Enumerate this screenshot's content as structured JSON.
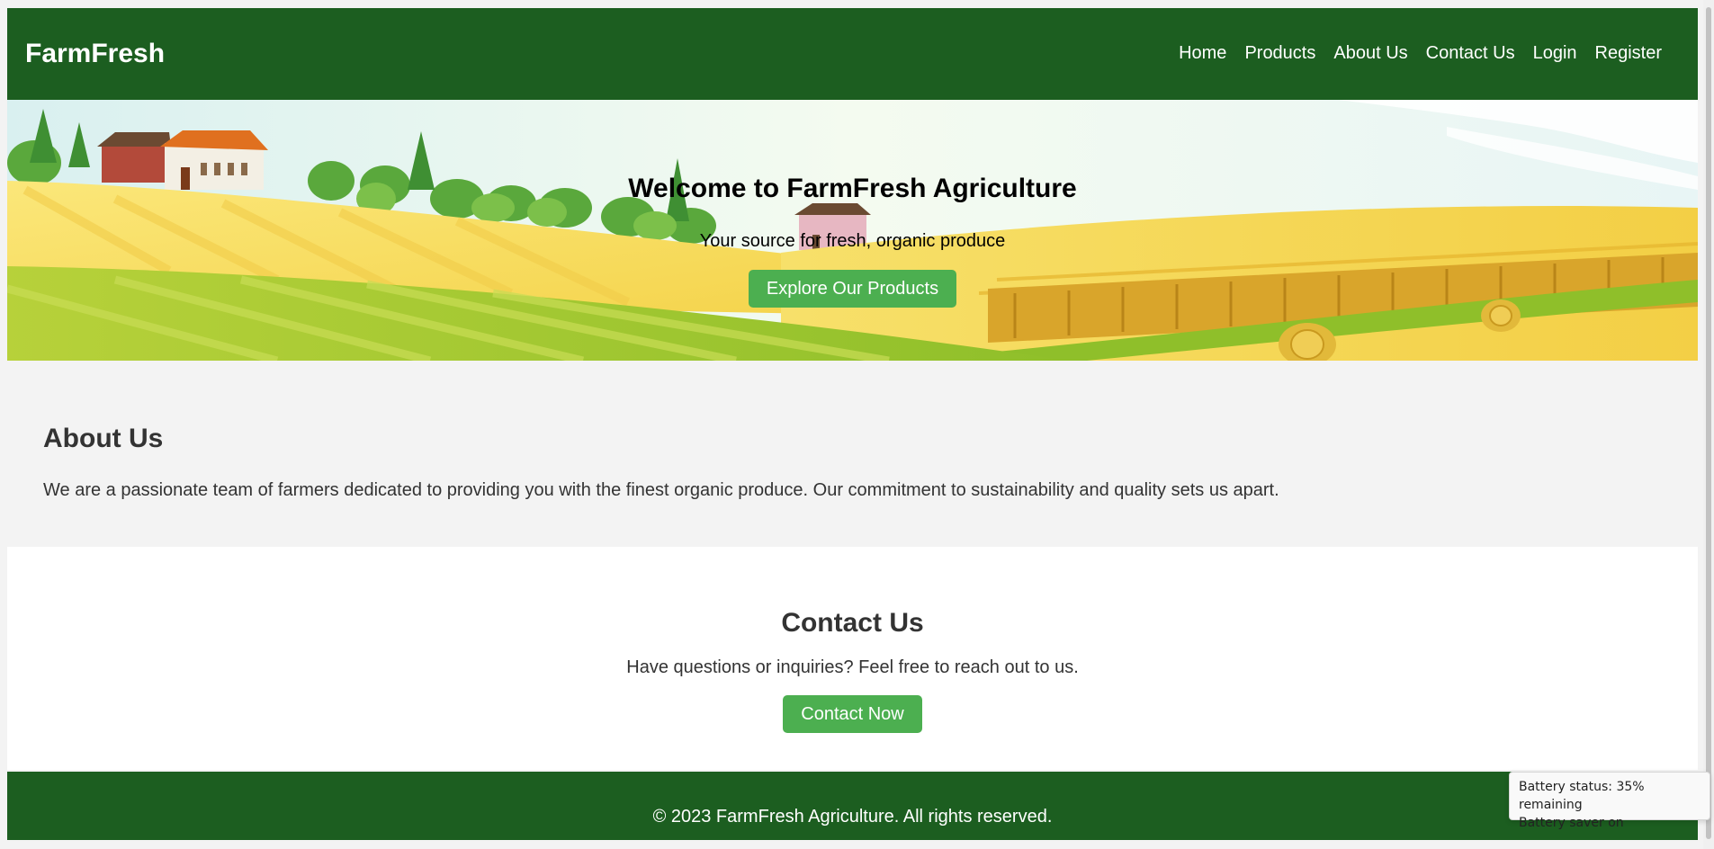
{
  "header": {
    "logo": "FarmFresh",
    "nav": [
      {
        "label": "Home"
      },
      {
        "label": "Products"
      },
      {
        "label": "About Us"
      },
      {
        "label": "Contact Us"
      },
      {
        "label": "Login"
      },
      {
        "label": "Register"
      }
    ]
  },
  "hero": {
    "title": "Welcome to FarmFresh Agriculture",
    "subtitle": "Your source for fresh, organic produce",
    "button": "Explore Our Products",
    "image": "farm-landscape-illustration"
  },
  "about": {
    "heading": "About Us",
    "text": "We are a passionate team of farmers dedicated to providing you with the finest organic produce. Our commitment to sustainability and quality sets us apart."
  },
  "contact": {
    "heading": "Contact Us",
    "text": "Have questions or inquiries? Feel free to reach out to us.",
    "button": "Contact Now"
  },
  "footer": {
    "text": "© 2023 FarmFresh Agriculture. All rights reserved."
  },
  "tooltip": {
    "line1": "Battery status: 35% remaining",
    "line2": "Battery saver on"
  },
  "colors": {
    "brand_green": "#1c5e20",
    "button_green": "#4caf50",
    "background": "#f3f3f3"
  }
}
